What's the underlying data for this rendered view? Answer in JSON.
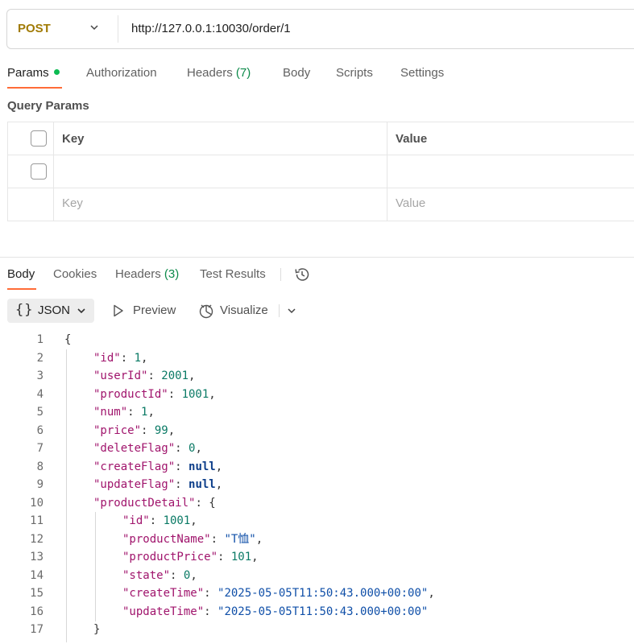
{
  "request": {
    "method": "POST",
    "url": "http://127.0.0.1:10030/order/1"
  },
  "request_tabs": {
    "params": "Params",
    "authorization": "Authorization",
    "headers": "Headers",
    "headers_count": "(7)",
    "body": "Body",
    "scripts": "Scripts",
    "settings": "Settings"
  },
  "query_params": {
    "title": "Query Params",
    "key_header": "Key",
    "value_header": "Value",
    "key_placeholder": "Key",
    "value_placeholder": "Value"
  },
  "response_tabs": {
    "body": "Body",
    "cookies": "Cookies",
    "headers": "Headers",
    "headers_count": "(3)",
    "test_results": "Test Results"
  },
  "response_toolbar": {
    "format": "JSON",
    "preview": "Preview",
    "visualize": "Visualize"
  },
  "code_lines": [
    {
      "num": "1",
      "indent": 0,
      "parts": [
        {
          "t": "{",
          "c": "p"
        }
      ]
    },
    {
      "num": "2",
      "indent": 1,
      "parts": [
        {
          "t": "\"id\"",
          "c": "k"
        },
        {
          "t": ": ",
          "c": "p"
        },
        {
          "t": "1",
          "c": "n"
        },
        {
          "t": ",",
          "c": "p"
        }
      ]
    },
    {
      "num": "3",
      "indent": 1,
      "parts": [
        {
          "t": "\"userId\"",
          "c": "k"
        },
        {
          "t": ": ",
          "c": "p"
        },
        {
          "t": "2001",
          "c": "n"
        },
        {
          "t": ",",
          "c": "p"
        }
      ]
    },
    {
      "num": "4",
      "indent": 1,
      "parts": [
        {
          "t": "\"productId\"",
          "c": "k"
        },
        {
          "t": ": ",
          "c": "p"
        },
        {
          "t": "1001",
          "c": "n"
        },
        {
          "t": ",",
          "c": "p"
        }
      ]
    },
    {
      "num": "5",
      "indent": 1,
      "parts": [
        {
          "t": "\"num\"",
          "c": "k"
        },
        {
          "t": ": ",
          "c": "p"
        },
        {
          "t": "1",
          "c": "n"
        },
        {
          "t": ",",
          "c": "p"
        }
      ]
    },
    {
      "num": "6",
      "indent": 1,
      "parts": [
        {
          "t": "\"price\"",
          "c": "k"
        },
        {
          "t": ": ",
          "c": "p"
        },
        {
          "t": "99",
          "c": "n"
        },
        {
          "t": ",",
          "c": "p"
        }
      ]
    },
    {
      "num": "7",
      "indent": 1,
      "parts": [
        {
          "t": "\"deleteFlag\"",
          "c": "k"
        },
        {
          "t": ": ",
          "c": "p"
        },
        {
          "t": "0",
          "c": "n"
        },
        {
          "t": ",",
          "c": "p"
        }
      ]
    },
    {
      "num": "8",
      "indent": 1,
      "parts": [
        {
          "t": "\"createFlag\"",
          "c": "k"
        },
        {
          "t": ": ",
          "c": "p"
        },
        {
          "t": "null",
          "c": "nl"
        },
        {
          "t": ",",
          "c": "p"
        }
      ]
    },
    {
      "num": "9",
      "indent": 1,
      "parts": [
        {
          "t": "\"updateFlag\"",
          "c": "k"
        },
        {
          "t": ": ",
          "c": "p"
        },
        {
          "t": "null",
          "c": "nl"
        },
        {
          "t": ",",
          "c": "p"
        }
      ]
    },
    {
      "num": "10",
      "indent": 1,
      "parts": [
        {
          "t": "\"productDetail\"",
          "c": "k"
        },
        {
          "t": ": {",
          "c": "p"
        }
      ]
    },
    {
      "num": "11",
      "indent": 2,
      "parts": [
        {
          "t": "\"id\"",
          "c": "k"
        },
        {
          "t": ": ",
          "c": "p"
        },
        {
          "t": "1001",
          "c": "n"
        },
        {
          "t": ",",
          "c": "p"
        }
      ]
    },
    {
      "num": "12",
      "indent": 2,
      "parts": [
        {
          "t": "\"productName\"",
          "c": "k"
        },
        {
          "t": ": ",
          "c": "p"
        },
        {
          "t": "\"T恤\"",
          "c": "s"
        },
        {
          "t": ",",
          "c": "p"
        }
      ]
    },
    {
      "num": "13",
      "indent": 2,
      "parts": [
        {
          "t": "\"productPrice\"",
          "c": "k"
        },
        {
          "t": ": ",
          "c": "p"
        },
        {
          "t": "101",
          "c": "n"
        },
        {
          "t": ",",
          "c": "p"
        }
      ]
    },
    {
      "num": "14",
      "indent": 2,
      "parts": [
        {
          "t": "\"state\"",
          "c": "k"
        },
        {
          "t": ": ",
          "c": "p"
        },
        {
          "t": "0",
          "c": "n"
        },
        {
          "t": ",",
          "c": "p"
        }
      ]
    },
    {
      "num": "15",
      "indent": 2,
      "parts": [
        {
          "t": "\"createTime\"",
          "c": "k"
        },
        {
          "t": ": ",
          "c": "p"
        },
        {
          "t": "\"2025-05-05T11:50:43.000+00:00\"",
          "c": "s"
        },
        {
          "t": ",",
          "c": "p"
        }
      ]
    },
    {
      "num": "16",
      "indent": 2,
      "parts": [
        {
          "t": "\"updateTime\"",
          "c": "k"
        },
        {
          "t": ": ",
          "c": "p"
        },
        {
          "t": "\"2025-05-05T11:50:43.000+00:00\"",
          "c": "s"
        }
      ]
    },
    {
      "num": "17",
      "indent": 1,
      "parts": [
        {
          "t": "}",
          "c": "p"
        }
      ]
    }
  ],
  "colors": {
    "accent": "#ff6c37",
    "method": "#a17b06",
    "status_dot": "#0cbb52",
    "json_key": "#a0146c",
    "json_number": "#0a7a65",
    "json_string": "#0f4fa8"
  }
}
